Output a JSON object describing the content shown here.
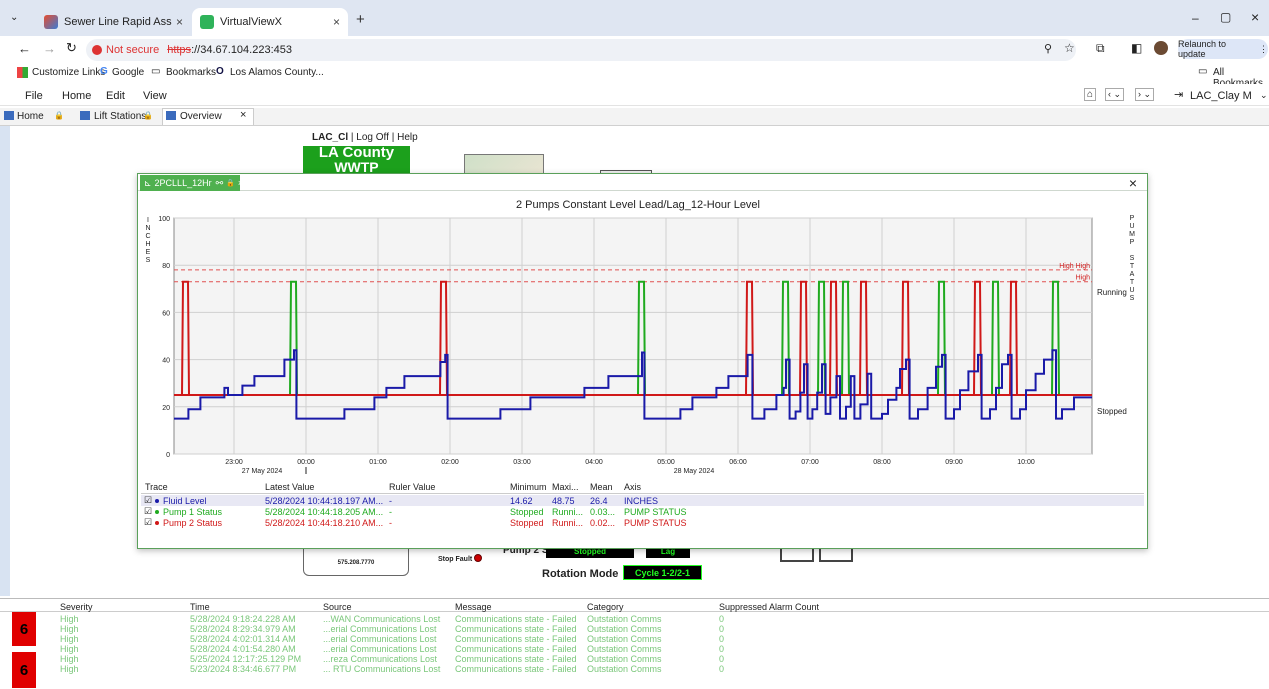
{
  "browser": {
    "tabs": [
      {
        "label": "Sewer Line Rapid Assessment T",
        "active": false
      },
      {
        "label": "VirtualViewX",
        "active": true
      }
    ],
    "new_tab": "+",
    "window_controls": [
      "–",
      "▢",
      "×"
    ],
    "not_secure": "Not secure",
    "url_scheme": "https",
    "url_rest": "://34.67.104.223:453",
    "relaunch": "Relaunch to update",
    "bookmarks": [
      "Customize Links",
      "Google",
      "Bookmarks",
      "Los Alamos County..."
    ],
    "all_bookmarks": "All Bookmarks"
  },
  "app": {
    "menu": [
      "File",
      "Home",
      "Edit",
      "View"
    ],
    "user": "LAC_Clay M",
    "tabs": [
      "Home",
      "Lift Stations",
      "Overview"
    ],
    "header_user": "LAC_Cl",
    "log_off": "Log Off",
    "help": "Help",
    "county_title": "LA County",
    "county_sub": "WWTP",
    "phone": "575.208.7770",
    "stop_fault": "Stop Fault",
    "pump2_states": "Pump 2 States",
    "pump2_state_value": "Stopped",
    "lag_value": "Lag",
    "rotation_mode": "Rotation Mode",
    "rotation_value": "Cycle 1-2/2-1"
  },
  "popup": {
    "tab_label": "2PCLLL_12Hr",
    "close": "×"
  },
  "chart_data": {
    "type": "line",
    "title": "2 Pumps Constant Level  Lead/Lag_12-Hour Level",
    "left_axis_label": "INCHES",
    "right_axis_label": "PUMP STATUS",
    "ylim": [
      0,
      100
    ],
    "yticks": [
      0,
      20,
      40,
      60,
      80,
      100
    ],
    "x_tick_labels": [
      "23:00",
      "00:00",
      "01:00",
      "02:00",
      "03:00",
      "04:00",
      "05:00",
      "06:00",
      "07:00",
      "08:00",
      "09:00",
      "10:00"
    ],
    "x_date_labels": [
      "27 May 2024",
      "28 May 2024"
    ],
    "right_labels": {
      "running": "Running",
      "stopped": "Stopped"
    },
    "thresholds": [
      {
        "label": "High High",
        "value": 78
      },
      {
        "label": "High",
        "value": 73
      }
    ],
    "series": [
      {
        "name": "Fluid Level",
        "color": "#1a1aa8"
      },
      {
        "name": "Pump 1 Status",
        "color": "#1faa1f",
        "run_times": [
          "23:50",
          "04:40",
          "06:40",
          "07:10",
          "07:30",
          "08:50",
          "09:35",
          "10:25"
        ]
      },
      {
        "name": "Pump 2 Status",
        "color": "#d01818",
        "run_times": [
          "22:20",
          "01:55",
          "06:10",
          "06:55",
          "07:20",
          "07:45",
          "08:20",
          "09:20",
          "09:50"
        ]
      }
    ]
  },
  "legend": {
    "headers": [
      "Trace",
      "Latest Value",
      "Ruler Value",
      "Minimum",
      "Maxi...",
      "Mean",
      "Axis"
    ],
    "rows": [
      {
        "trace": "Fluid Level",
        "latest": "5/28/2024 10:44:18.197 AM...",
        "ruler": "-",
        "min": "14.62",
        "max": "48.75",
        "mean": "26.4",
        "axis": "INCHES",
        "color": "#1a1aa8"
      },
      {
        "trace": "Pump 1 Status",
        "latest": "5/28/2024 10:44:18.205 AM...",
        "ruler": "-",
        "min": "Stopped",
        "max": "Runni...",
        "mean": "0.03...",
        "axis": "PUMP STATUS",
        "color": "#1faa1f"
      },
      {
        "trace": "Pump 2 Status",
        "latest": "5/28/2024 10:44:18.210 AM...",
        "ruler": "-",
        "min": "Stopped",
        "max": "Runni...",
        "mean": "0.02...",
        "axis": "PUMP STATUS",
        "color": "#d01818"
      }
    ]
  },
  "alarms": {
    "headers": [
      "Severity",
      "Time",
      "Source",
      "Message",
      "Category",
      "Suppressed Alarm Count"
    ],
    "count_top": "6",
    "count_bottom": "6",
    "rows": [
      {
        "severity": "High",
        "time": "5/28/2024 9:18:24.228 AM",
        "source": "...WAN Communications Lost",
        "message": "Communications state - Failed",
        "category": "Outstation Comms",
        "count": "0"
      },
      {
        "severity": "High",
        "time": "5/28/2024 8:29:34.979 AM",
        "source": "...erial Communications Lost",
        "message": "Communications state - Failed",
        "category": "Outstation Comms",
        "count": "0"
      },
      {
        "severity": "High",
        "time": "5/28/2024 4:02:01.314 AM",
        "source": "...erial Communications Lost",
        "message": "Communications state - Failed",
        "category": "Outstation Comms",
        "count": "0"
      },
      {
        "severity": "High",
        "time": "5/28/2024 4:01:54.280 AM",
        "source": "...erial Communications Lost",
        "message": "Communications state - Failed",
        "category": "Outstation Comms",
        "count": "0"
      },
      {
        "severity": "High",
        "time": "5/25/2024 12:17:25.129 PM",
        "source": "...reza Communications Lost",
        "message": "Communications state - Failed",
        "category": "Outstation Comms",
        "count": "0"
      },
      {
        "severity": "High",
        "time": "5/23/2024 8:34:46.677 PM",
        "source": "... RTU Communications Lost",
        "message": "Communications state - Failed",
        "category": "Outstation Comms",
        "count": "0"
      }
    ]
  }
}
